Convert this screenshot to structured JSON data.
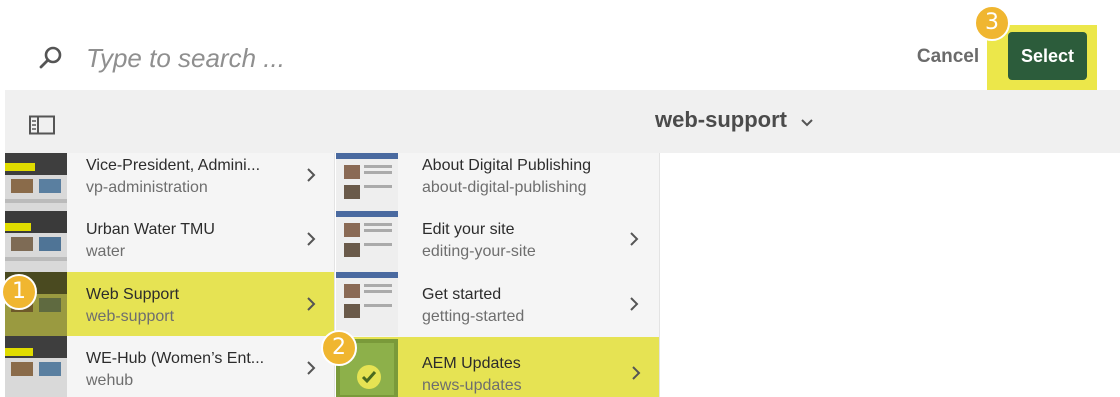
{
  "search": {
    "placeholder": "Type to search ..."
  },
  "toolbar": {
    "cancel_label": "Cancel",
    "select_label": "Select"
  },
  "header": {
    "folder_title": "web-support"
  },
  "columns": [
    {
      "items": [
        {
          "title": "Vice-President, Admini...",
          "name": "vp-administration",
          "selected": false
        },
        {
          "title": "Urban Water TMU",
          "name": "water",
          "selected": false
        },
        {
          "title": "Web Support",
          "name": "web-support",
          "selected": true
        },
        {
          "title": "WE-Hub (Women’s Ent...",
          "name": "wehub",
          "selected": false
        }
      ]
    },
    {
      "items": [
        {
          "title": "About Digital Publishing",
          "name": "about-digital-publishing",
          "selected": false
        },
        {
          "title": "Edit your site",
          "name": "editing-your-site",
          "selected": false
        },
        {
          "title": "Get started",
          "name": "getting-started",
          "selected": false
        },
        {
          "title": "AEM Updates",
          "name": "news-updates",
          "selected": true
        }
      ]
    }
  ],
  "badges": [
    "1",
    "2",
    "3"
  ],
  "colors": {
    "highlight": "#e6e353",
    "select_button": "#2c5c3b",
    "badge": "#f0b630"
  }
}
